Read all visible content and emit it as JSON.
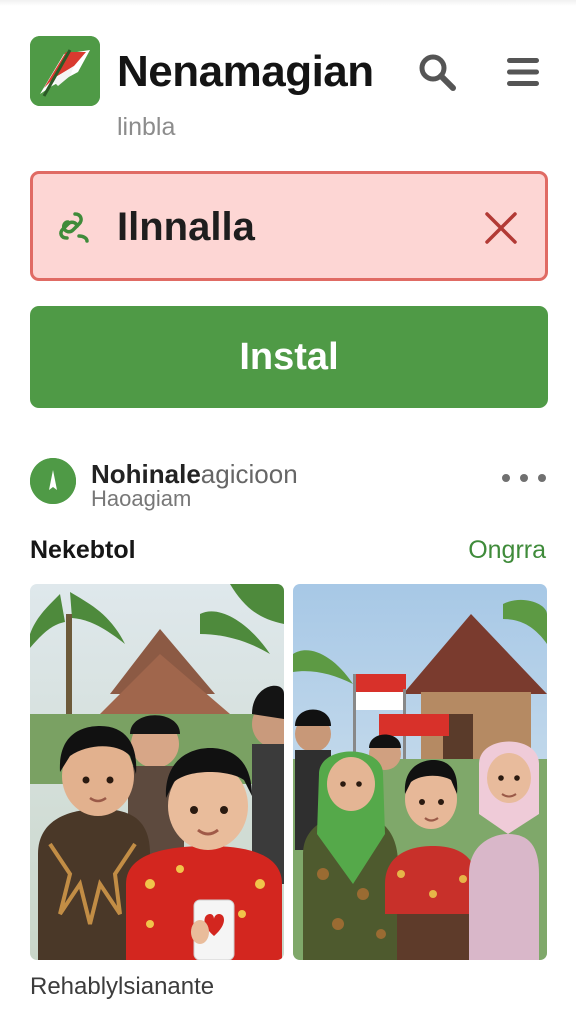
{
  "app": {
    "title": "Nenamagian",
    "subtitle": "linbla",
    "icon": "flag-app-icon"
  },
  "header_actions": {
    "search_icon": "search-icon",
    "menu_icon": "menu-icon"
  },
  "alert": {
    "text": "Ilnnalla",
    "icon": "link-icon",
    "close_icon": "close-icon",
    "colors": {
      "background": "#fdd6d4",
      "border": "#e06b64"
    }
  },
  "install_button": {
    "label": "Instal",
    "color": "#4f9a46"
  },
  "developer": {
    "name_bold": "Nohinale",
    "name_rest": "agicioon",
    "handle": "Haoagiam",
    "more_icon": "more-horizontal-icon"
  },
  "screenshots_section": {
    "title": "Nekebtol",
    "link": "Ongrra",
    "link_color": "#3f8b3a",
    "images": [
      {
        "name": "screenshot-children-village",
        "description_icon": "photo"
      },
      {
        "name": "screenshot-children-flags",
        "description_icon": "photo"
      }
    ]
  },
  "caption": "Rehablylsianante"
}
